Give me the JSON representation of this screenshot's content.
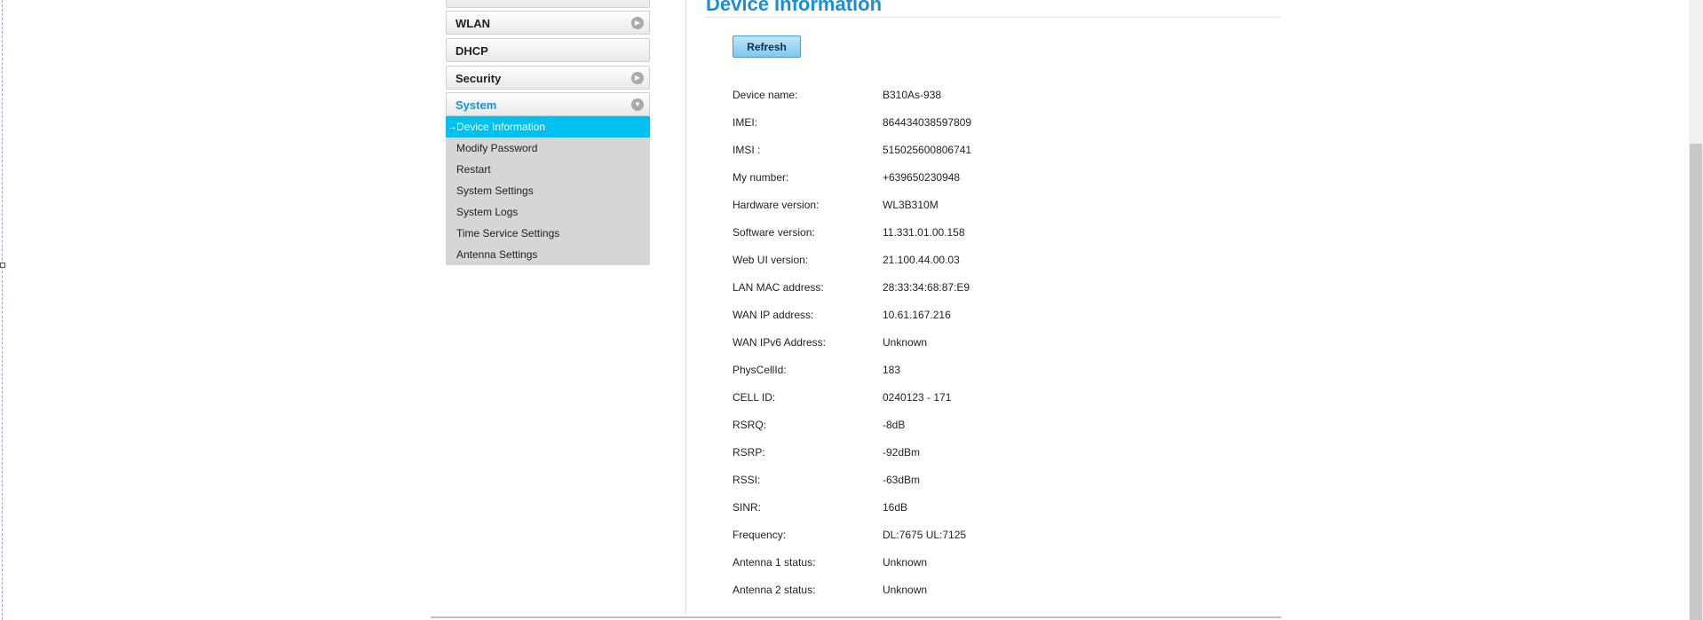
{
  "sidebar": {
    "menu": [
      {
        "label": "WLAN",
        "icon": "arrow-right-circle-icon"
      },
      {
        "label": "DHCP",
        "icon": ""
      },
      {
        "label": "Security",
        "icon": "arrow-right-circle-icon"
      },
      {
        "label": "System",
        "icon": "arrow-down-circle-icon"
      }
    ],
    "system_submenu": [
      "Device Information",
      "Modify Password",
      "Restart",
      "System Settings",
      "System Logs",
      "Time Service Settings",
      "Antenna Settings"
    ],
    "active_index": 0
  },
  "main": {
    "title": "Device Information",
    "refresh_label": "Refresh",
    "info": [
      {
        "key": "Device name:",
        "value": "B310As-938"
      },
      {
        "key": "IMEI:",
        "value": "864434038597809"
      },
      {
        "key": "IMSI :",
        "value": "515025600806741"
      },
      {
        "key": "My number:",
        "value": "+639650230948"
      },
      {
        "key": "Hardware version:",
        "value": "WL3B310M"
      },
      {
        "key": "Software version:",
        "value": "11.331.01.00.158"
      },
      {
        "key": "Web UI version:",
        "value": "21.100.44.00.03"
      },
      {
        "key": "LAN MAC address:",
        "value": "28:33:34:68:87:E9"
      },
      {
        "key": "WAN IP address:",
        "value": "10.61.167.216"
      },
      {
        "key": "WAN IPv6 Address:",
        "value": "Unknown"
      },
      {
        "key": "PhysCellId:",
        "value": "183"
      },
      {
        "key": "CELL ID:",
        "value": "0240123 - 171"
      },
      {
        "key": "RSRQ:",
        "value": "-8dB"
      },
      {
        "key": "RSRP:",
        "value": "-92dBm"
      },
      {
        "key": "RSSI:",
        "value": "-63dBm"
      },
      {
        "key": "SINR:",
        "value": "16dB"
      },
      {
        "key": "Frequency:",
        "value": "DL:7675 UL:7125"
      },
      {
        "key": "Antenna 1 status:",
        "value": "Unknown"
      },
      {
        "key": "Antenna 2 status:",
        "value": "Unknown"
      }
    ]
  },
  "colors": {
    "accent": "#1a8fd6",
    "active_item": "#00c0f0",
    "submenu_bg": "#d6d6d6"
  }
}
